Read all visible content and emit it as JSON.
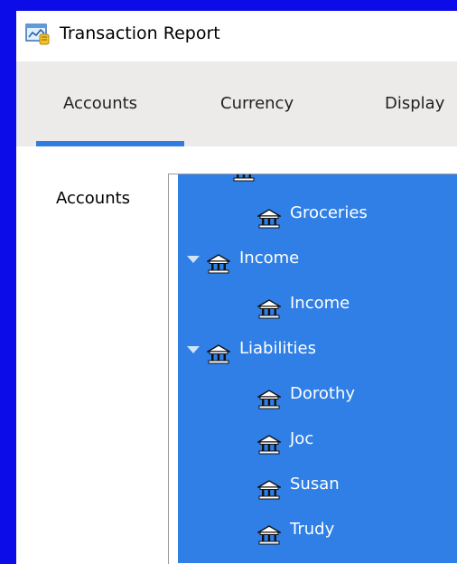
{
  "window": {
    "title": "Transaction Report"
  },
  "tabs": [
    {
      "label": "Accounts",
      "selected": true
    },
    {
      "label": "Currency",
      "selected": false
    },
    {
      "label": "Display",
      "selected": false
    }
  ],
  "accounts_panel": {
    "label": "Accounts",
    "tree": [
      {
        "label": "Groceries",
        "level": 1,
        "expanded": null
      },
      {
        "label": "Income",
        "level": 0,
        "expanded": true
      },
      {
        "label": "Income",
        "level": 1,
        "expanded": null
      },
      {
        "label": "Liabilities",
        "level": 0,
        "expanded": true
      },
      {
        "label": "Dorothy",
        "level": 1,
        "expanded": null
      },
      {
        "label": "Joc",
        "level": 1,
        "expanded": null
      },
      {
        "label": "Susan",
        "level": 1,
        "expanded": null
      },
      {
        "label": "Trudy",
        "level": 1,
        "expanded": null
      }
    ]
  },
  "colors": {
    "selection": "#2f7fe6",
    "accent": "#2f7de0",
    "desktop": "#0c0ce8"
  },
  "icons": {
    "app": "report-chart-icon",
    "account": "bank-icon",
    "expand": "triangle-down-icon"
  }
}
